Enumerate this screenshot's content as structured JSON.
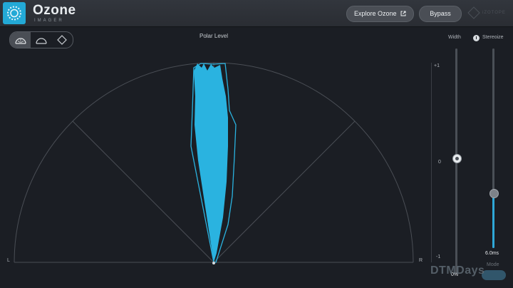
{
  "header": {
    "title": "Ozone",
    "subtitle": "IMAGER",
    "explore_label": "Explore Ozone",
    "bypass_label": "Bypass",
    "brand": "iZOTOPE"
  },
  "view_modes": [
    {
      "name": "polar-sample",
      "icon": "polar-sample-icon",
      "active": true
    },
    {
      "name": "polar-level",
      "icon": "polar-level-icon",
      "active": false
    },
    {
      "name": "lissajous",
      "icon": "lissajous-icon",
      "active": false
    }
  ],
  "meter": {
    "title": "Polar Level",
    "left_label": "L",
    "right_label": "R",
    "accent": "#2ab3e0"
  },
  "correlation_scale": {
    "top": "+1",
    "mid": "0",
    "bottom": "-1"
  },
  "width": {
    "label": "Width",
    "value": "0%",
    "level": 0.5
  },
  "stereoize": {
    "label": "Stereoize",
    "value": "6.0ms",
    "mode_label": "Mode",
    "level": 0.27
  },
  "watermark": "DTMDays",
  "colors": {
    "accent": "#2ab3e0",
    "background": "#1b1e24",
    "header": "#2d3036"
  }
}
